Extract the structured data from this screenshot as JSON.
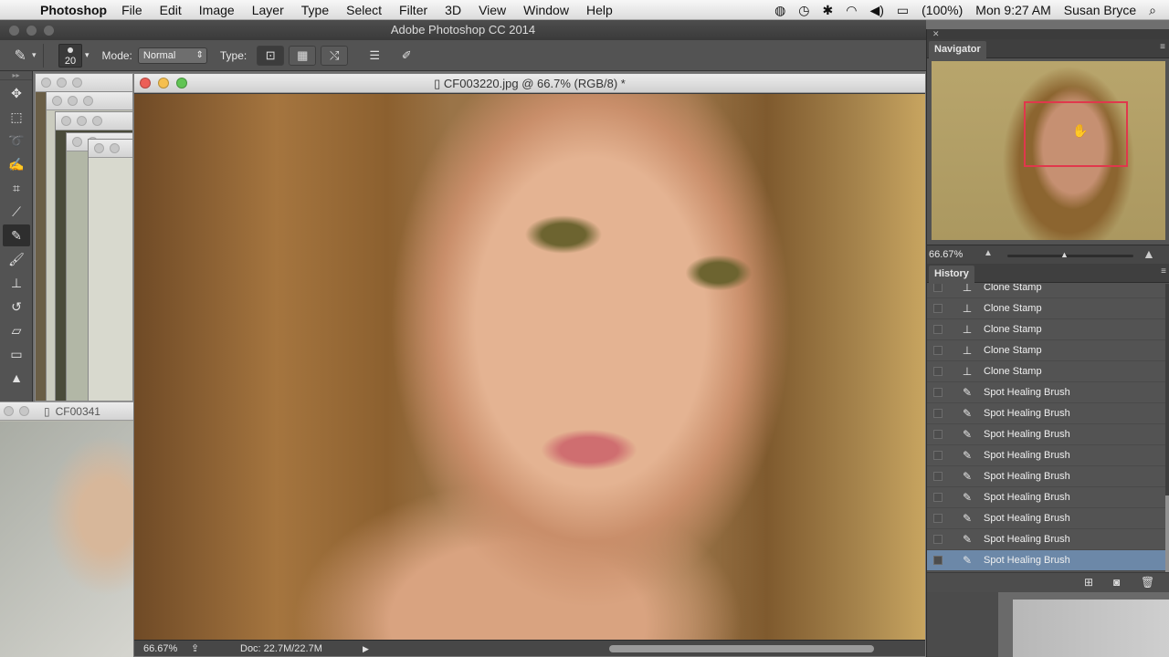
{
  "menubar": {
    "apple_icon": "apple-icon",
    "app_name": "Photoshop",
    "menus": [
      "File",
      "Edit",
      "Image",
      "Layer",
      "Type",
      "Select",
      "Filter",
      "3D",
      "View",
      "Window",
      "Help"
    ],
    "battery": "(100%)",
    "clock": "Mon 9:27 AM",
    "user": "Susan Bryce"
  },
  "app": {
    "title": "Adobe Photoshop CC 2014"
  },
  "options_bar": {
    "brush_size": "20",
    "mode_label": "Mode:",
    "mode_value": "Normal",
    "type_label": "Type:"
  },
  "document": {
    "title": "CF003220.jpg @ 66.7% (RGB/8) *",
    "zoom": "66.67%",
    "doc_size": "Doc: 22.7M/22.7M"
  },
  "background_doc": {
    "title": "CF00341"
  },
  "navigator": {
    "tab": "Navigator",
    "zoom": "66.67%"
  },
  "history": {
    "tab": "History",
    "items": [
      {
        "label": "Clone Stamp",
        "icon": "clone-stamp-icon"
      },
      {
        "label": "Clone Stamp",
        "icon": "clone-stamp-icon"
      },
      {
        "label": "Clone Stamp",
        "icon": "clone-stamp-icon"
      },
      {
        "label": "Clone Stamp",
        "icon": "clone-stamp-icon"
      },
      {
        "label": "Clone Stamp",
        "icon": "clone-stamp-icon"
      },
      {
        "label": "Spot Healing Brush",
        "icon": "spot-healing-brush-icon"
      },
      {
        "label": "Spot Healing Brush",
        "icon": "spot-healing-brush-icon"
      },
      {
        "label": "Spot Healing Brush",
        "icon": "spot-healing-brush-icon"
      },
      {
        "label": "Spot Healing Brush",
        "icon": "spot-healing-brush-icon"
      },
      {
        "label": "Spot Healing Brush",
        "icon": "spot-healing-brush-icon"
      },
      {
        "label": "Spot Healing Brush",
        "icon": "spot-healing-brush-icon"
      },
      {
        "label": "Spot Healing Brush",
        "icon": "spot-healing-brush-icon"
      },
      {
        "label": "Spot Healing Brush",
        "icon": "spot-healing-brush-icon"
      },
      {
        "label": "Spot Healing Brush",
        "icon": "spot-healing-brush-icon",
        "selected": true
      }
    ]
  },
  "colors": {
    "panel_bg": "#535353",
    "selection": "#6c88a8",
    "navigator_box": "#e0384c",
    "traffic_close": "#ec5f57",
    "traffic_min": "#f5bf4f",
    "traffic_max": "#61c454"
  }
}
